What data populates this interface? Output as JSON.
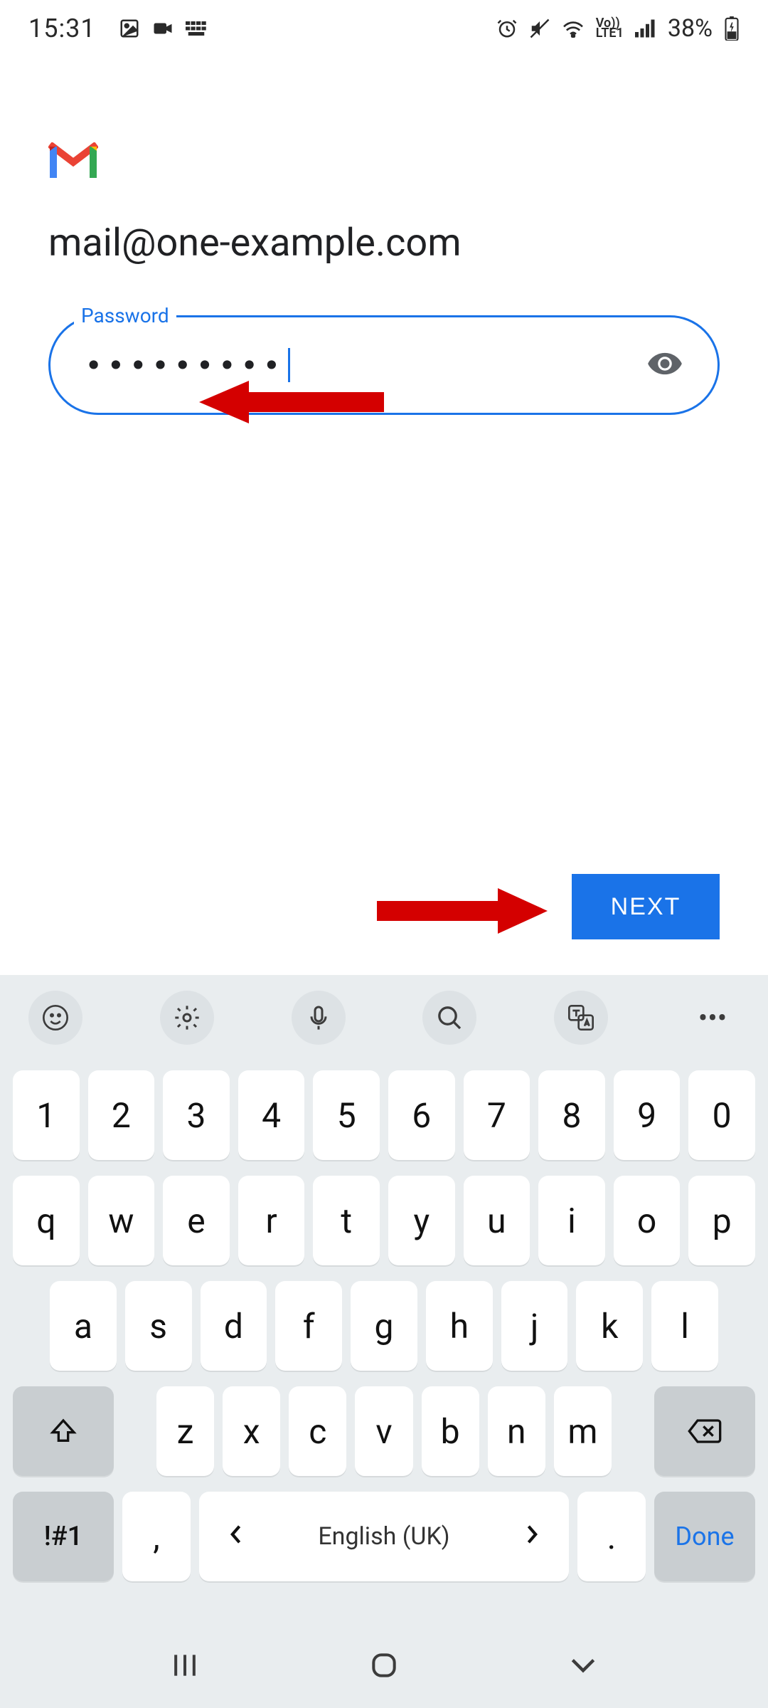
{
  "status": {
    "time": "15:31",
    "battery_pct": "38%"
  },
  "login": {
    "email": "mail@one-example.com",
    "password_label": "Password",
    "password_masked": "•••••••••",
    "next_label": "NEXT"
  },
  "keyboard": {
    "row1": [
      "1",
      "2",
      "3",
      "4",
      "5",
      "6",
      "7",
      "8",
      "9",
      "0"
    ],
    "row2": [
      "q",
      "w",
      "e",
      "r",
      "t",
      "y",
      "u",
      "i",
      "o",
      "p"
    ],
    "row3": [
      "a",
      "s",
      "d",
      "f",
      "g",
      "h",
      "j",
      "k",
      "l"
    ],
    "row4": [
      "z",
      "x",
      "c",
      "v",
      "b",
      "n",
      "m"
    ],
    "sym_label": "!#1",
    "comma": ",",
    "dot": ".",
    "space_lang": "English (UK)",
    "done_label": "Done"
  }
}
